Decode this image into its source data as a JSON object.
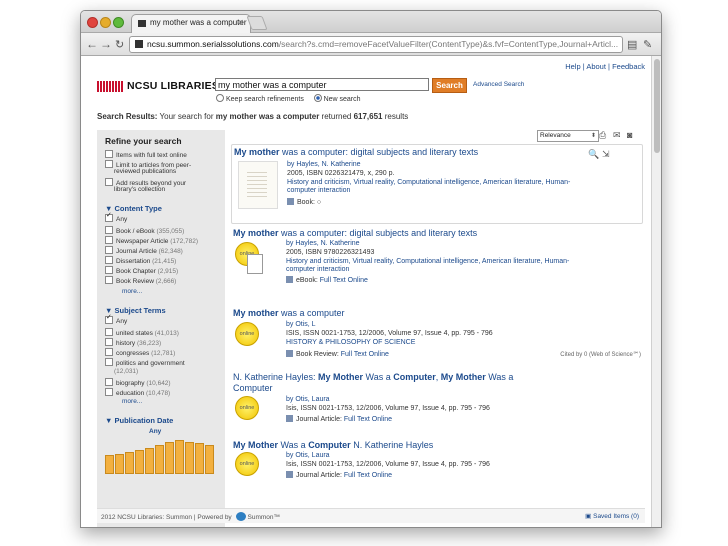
{
  "browser": {
    "tab_title": "my mother was a computer",
    "url_host": "ncsu.summon.serialssolutions.com",
    "url_path": "/search?s.cmd=removeFacetValueFilter(ContentType)&s.fvf=ContentType,Journal+Articl..."
  },
  "header": {
    "help": "Help",
    "about": "About",
    "feedback": "Feedback",
    "logo_text": "NCSU LIBRARIES",
    "search_value": "my mother was a computer",
    "search_button": "Search",
    "advanced": "Advanced Search",
    "radio_keep": "Keep search refinements",
    "radio_new": "New search"
  },
  "results_summary": {
    "prefix": "Search Results:",
    "middle": " Your search for ",
    "query": "my mother was a computer",
    "returned": " returned ",
    "count": "617,651",
    "suffix": " results"
  },
  "sidebar": {
    "refine_title": "Refine your search",
    "refine": [
      "Items with full text online",
      "Limit to articles from peer-",
      "reviewed publications",
      "Add results beyond your",
      "library's collection"
    ],
    "content_type_title": "▼ Content Type",
    "content_any": "Any",
    "content_types": [
      {
        "label": "Book / eBook",
        "count": "(355,055)"
      },
      {
        "label": "Newspaper Article",
        "count": "(172,782)"
      },
      {
        "label": "Journal Article",
        "count": "(62,348)"
      },
      {
        "label": "Dissertation",
        "count": "(21,415)"
      },
      {
        "label": "Book Chapter",
        "count": "(2,915)"
      },
      {
        "label": "Book Review",
        "count": "(2,666)"
      }
    ],
    "more1": "more...",
    "subject_title": "▼ Subject Terms",
    "subject_any": "Any",
    "subjects": [
      {
        "label": "united states",
        "count": "(41,013)"
      },
      {
        "label": "history",
        "count": "(36,223)"
      },
      {
        "label": "congresses",
        "count": "(12,781)"
      },
      {
        "label": "politics and government",
        "count": ""
      },
      {
        "label": "",
        "count": "(12,031)"
      },
      {
        "label": "biography",
        "count": "(10,642)"
      },
      {
        "label": "education",
        "count": "(10,478)"
      }
    ],
    "more2": "more...",
    "pubdate_title": "▼ Publication Date",
    "pubdate_any": "Any",
    "pubdate_bars": [
      0.55,
      0.6,
      0.65,
      0.7,
      0.75,
      0.85,
      0.95,
      1.0,
      0.95,
      0.9,
      0.85
    ]
  },
  "sort": {
    "selected": "Relevance"
  },
  "results": [
    {
      "title_bold": "My mother",
      "title_rest": " was a computer",
      "title_tail": ": digital subjects and literary texts",
      "line1": "by Hayles, N. Katherine",
      "line2": "2005, ISBN 0226321479, x, 290 p.",
      "line3": "History and criticism, Virtual reality, Computational intelligence, American literature, Human-",
      "line4": "computer interaction",
      "format": "Book:",
      "format_link": ""
    },
    {
      "title_bold": "My mother",
      "title_rest": " was a computer",
      "title_tail": ": digital subjects and literary texts",
      "line1": "by Hayles, N. Katherine",
      "line2": "2005, ISBN 9780226321493",
      "line3": "History and criticism, Virtual reality, Computational intelligence, American literature, Human-",
      "line4": "computer interaction",
      "format": "eBook:",
      "format_link": "Full Text Online"
    },
    {
      "title_bold": "My mother",
      "title_rest": " was a computer",
      "title_tail": "",
      "line1": "by Otis, L",
      "line2": "ISIS, ISSN 0021-1753, 12/2006, Volume 97, Issue 4, pp. 795 - 796",
      "line3": "HISTORY & PHILOSOPHY OF SCIENCE",
      "format": "Book Review:",
      "format_link": "Full Text Online",
      "cited": "Cited by 0 (Web of Science℠)"
    },
    {
      "title_pre": "N. Katherine Hayles: ",
      "title_bold": "My Mother",
      "title_rest": " Was a ",
      "title_bold2": "Computer",
      "title_tail": ", ",
      "title_bold3": "My Mother",
      "title_tail2": " Was a",
      "title_line2": "Computer",
      "line1": "by Otis, Laura",
      "line2": "Isis, ISSN 0021-1753, 12/2006, Volume 97, Issue 4, pp. 795 - 796",
      "format": "Journal Article:",
      "format_link": "Full Text Online"
    },
    {
      "title_bold": "My Mother",
      "title_rest": " Was a ",
      "title_bold2": "Computer",
      "title_tail": " N. Katherine Hayles",
      "line1": "by Otis, Laura",
      "line2": "Isis, ISSN 0021-1753, 12/2006, Volume 97, Issue 4, pp. 795 - 796",
      "format": "Journal Article:",
      "format_link": "Full Text Online"
    }
  ],
  "badges": {
    "online": "online"
  },
  "footer": {
    "copyright": "2012 NCSU Libraries: Summon",
    "powered": "Powered by",
    "summon": "Summon™",
    "saved": "Saved Items (0)"
  }
}
